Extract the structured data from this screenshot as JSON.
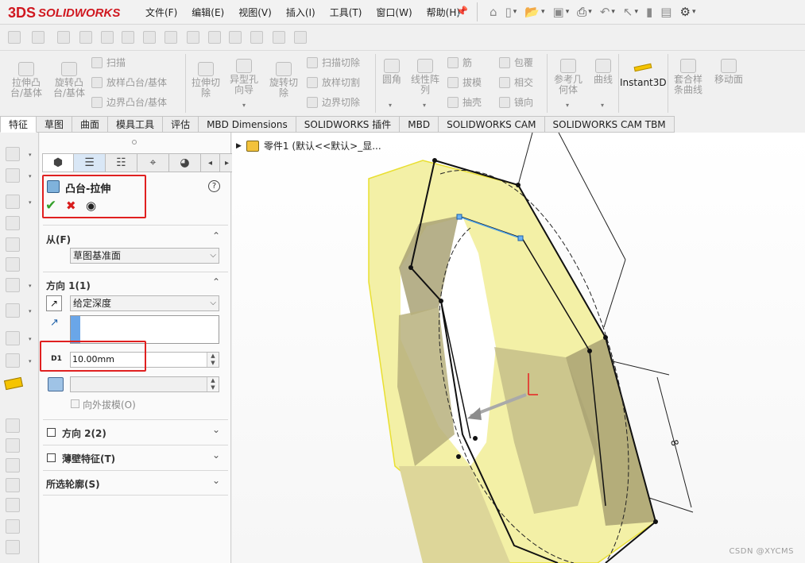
{
  "app": {
    "logo_text": "SOLIDWORKS",
    "logo_mark": "3DS"
  },
  "menu": [
    "文件(F)",
    "编辑(E)",
    "视图(V)",
    "插入(I)",
    "工具(T)",
    "窗口(W)",
    "帮助(H)"
  ],
  "ribbon": {
    "extrude_boss": "拉伸凸\n台/基体",
    "revolve_boss": "旋转凸\n台/基体",
    "sweep": "扫描",
    "loft": "放样凸台/基体",
    "boundary": "边界凸台/基体",
    "extrude_cut": "拉伸切\n除",
    "hole_wizard": "异型孔\n向导",
    "revolve_cut": "旋转切\n除",
    "sweep_cut": "扫描切除",
    "loft_cut": "放样切割",
    "boundary_cut": "边界切除",
    "fillet": "圆角",
    "linear_pattern": "线性阵\n列",
    "rib": "筋",
    "draft": "拔模",
    "shell": "抽壳",
    "wrap": "包覆",
    "intersect": "相交",
    "mirror": "镜向",
    "ref_geom": "参考几\n何体",
    "curves": "曲线",
    "instant3d": "Instant3D",
    "spline_curve": "套合样\n条曲线",
    "move_face": "移动面"
  },
  "tabs": [
    "特征",
    "草图",
    "曲面",
    "模具工具",
    "评估",
    "MBD Dimensions",
    "SOLIDWORKS 插件",
    "MBD",
    "SOLIDWORKS CAM",
    "SOLIDWORKS CAM TBM"
  ],
  "pm": {
    "title": "凸台-拉伸",
    "from_label": "从(F)",
    "from_value": "草图基准面",
    "dir1_label": "方向 1(1)",
    "dir1_type": "给定深度",
    "depth_value": "10.00mm",
    "outward_draft": "向外拔模(O)",
    "dir2_label": "方向 2(2)",
    "thin_label": "薄壁特征(T)",
    "contours_label": "所选轮廓(S)"
  },
  "tree": {
    "label": "零件1  (默认<<默认>_显..."
  },
  "watermark": "CSDN @XYCMS",
  "colors": {
    "accent_red": "#e02020",
    "model_face": "#f3f0a6",
    "model_edge": "#f0e63a"
  }
}
